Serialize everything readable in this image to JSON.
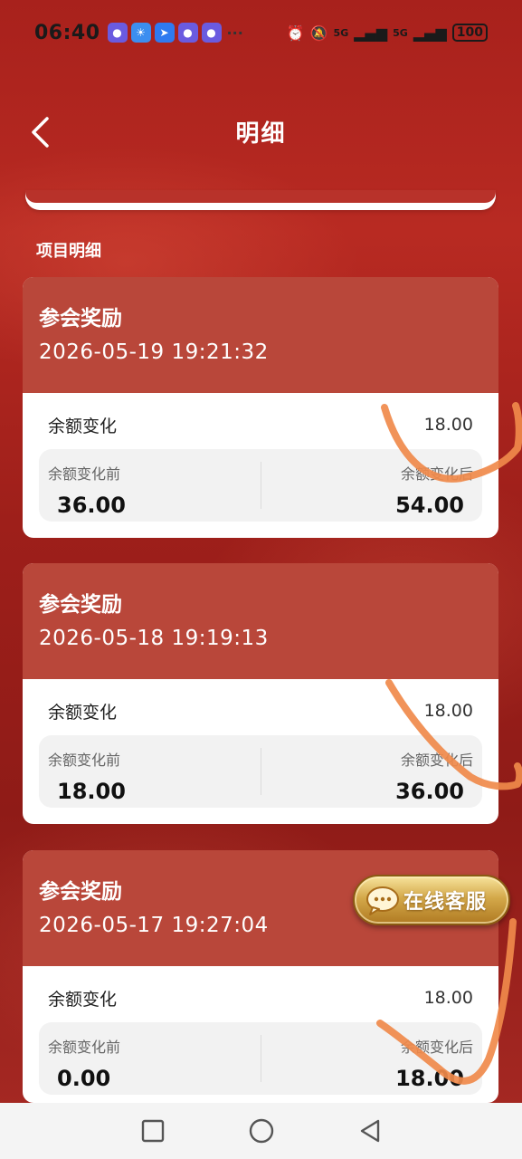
{
  "status_bar": {
    "time": "06:40",
    "more": "···",
    "signal_1": "5G",
    "signal_2": "5G",
    "battery": "100"
  },
  "header": {
    "title": "明细"
  },
  "section_label": "项目明细",
  "records": [
    {
      "title": "参会奖励",
      "datetime": "2026-05-19 19:21:32",
      "change_label": "余额变化",
      "change_amount": "18.00",
      "before_label": "余额变化前",
      "before_value": "36.00",
      "after_label": "余额变化后",
      "after_value": "54.00"
    },
    {
      "title": "参会奖励",
      "datetime": "2026-05-18 19:19:13",
      "change_label": "余额变化",
      "change_amount": "18.00",
      "before_label": "余额变化前",
      "before_value": "18.00",
      "after_label": "余额变化后",
      "after_value": "36.00"
    },
    {
      "title": "参会奖励",
      "datetime": "2026-05-17 19:27:04",
      "change_label": "余额变化",
      "change_amount": "18.00",
      "before_label": "余额变化前",
      "before_value": "0.00",
      "after_label": "余额变化后",
      "after_value": "18.00"
    }
  ],
  "customer_service": {
    "label": "在线客服"
  },
  "colors": {
    "background": "#a8211c",
    "card_header": "#b9473a",
    "scribble": "#f08a4b"
  }
}
